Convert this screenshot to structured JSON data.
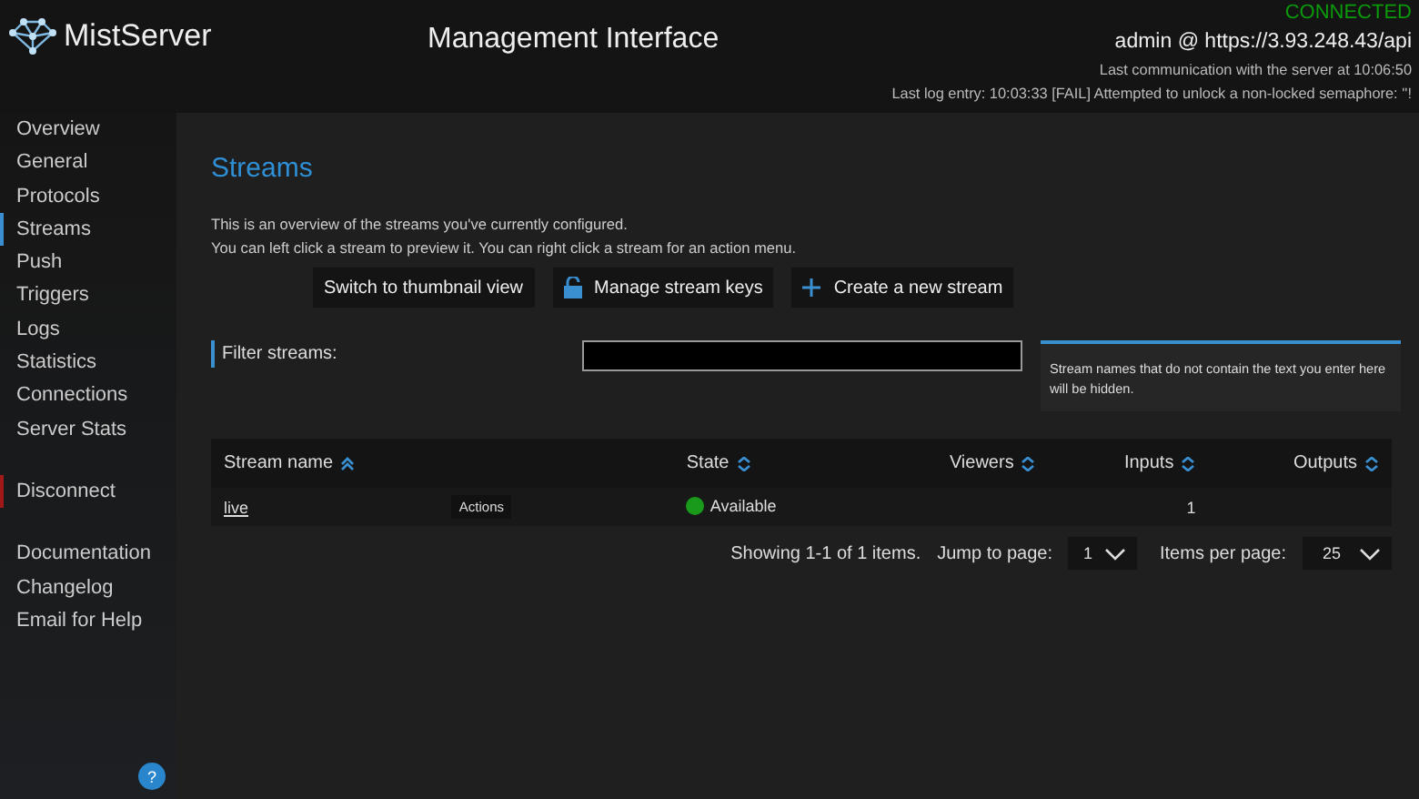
{
  "header": {
    "logo": "MistServer",
    "title": "Management Interface",
    "connection": "CONNECTED",
    "user": "admin @ https://3.93.248.43/api",
    "last_communication": "Last communication with the server at 10:06:50",
    "last_log": "Last log entry: 10:03:33 [FAIL] Attempted to unlock a non-locked semaphore: ''!"
  },
  "sidebar": {
    "groups": [
      {
        "items": [
          {
            "label": "Overview",
            "selected": false
          },
          {
            "label": "General",
            "selected": false
          },
          {
            "label": "Protocols",
            "selected": false
          },
          {
            "label": "Streams",
            "selected": true
          },
          {
            "label": "Push",
            "selected": false
          },
          {
            "label": "Triggers",
            "selected": false
          },
          {
            "label": "Logs",
            "selected": false
          },
          {
            "label": "Statistics",
            "selected": false
          },
          {
            "label": "Connections",
            "selected": false
          },
          {
            "label": "Server Stats",
            "selected": false
          }
        ]
      },
      {
        "items": [
          {
            "label": "Disconnect",
            "kind": "danger"
          }
        ]
      },
      {
        "items": [
          {
            "label": "Documentation",
            "selected": false
          },
          {
            "label": "Changelog",
            "selected": false
          },
          {
            "label": "Email for Help",
            "selected": false
          }
        ]
      }
    ],
    "help_button": "?"
  },
  "page": {
    "title": "Streams",
    "intro": [
      "This is an overview of the streams you've currently configured.",
      "You can left click a stream to preview it. You can right click a stream for an action menu."
    ],
    "buttons": [
      {
        "label": "Switch to thumbnail view"
      },
      {
        "label": "Manage stream keys"
      },
      {
        "label": "Create a new stream"
      }
    ],
    "filter": {
      "label": "Filter streams:",
      "help": "Stream names that do not contain the text you enter here will be hidden."
    },
    "table": {
      "columns": [
        {
          "label": "Stream name"
        },
        {
          "label": "State"
        },
        {
          "label": "Viewers"
        },
        {
          "label": "Inputs"
        },
        {
          "label": "Outputs"
        }
      ],
      "rows": [
        {
          "name": "live",
          "action": "Actions",
          "state": "Available",
          "color": "#1a9a1a",
          "inputs": "1"
        }
      ]
    },
    "pagination": {
      "summary": "Showing 1-1 of 1 items.",
      "jump_label": "Jump to page:",
      "page": "1",
      "per_page_label": "Items per page:",
      "per_page": "25"
    }
  }
}
